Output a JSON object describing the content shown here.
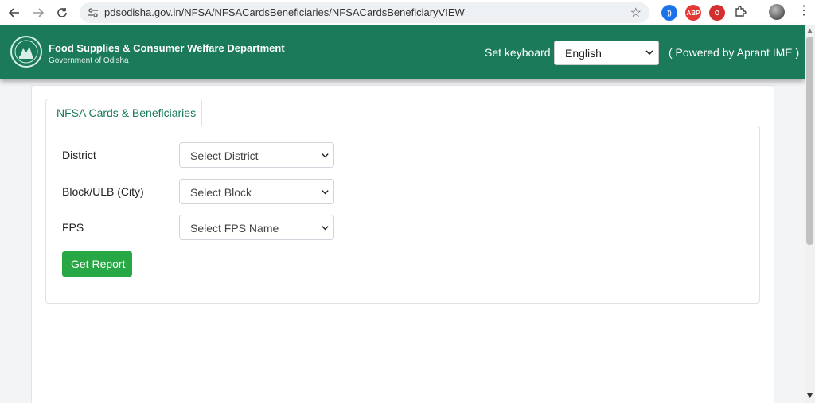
{
  "browser": {
    "url": "pdsodisha.gov.in/NFSA/NFSACardsBeneficiaries/NFSACardsBeneficiaryVIEW",
    "extensions": [
      {
        "name": "speaker-extension-icon",
        "color": "#1a73e8",
        "label": "))"
      },
      {
        "name": "adblock-icon",
        "color": "#e53935",
        "label": "ABP"
      },
      {
        "name": "opera-icon",
        "color": "#d32f2f",
        "label": "O"
      }
    ]
  },
  "header": {
    "department": "Food Supplies & Consumer Welfare Department",
    "government": "Government of Odisha",
    "keyboard_label": "Set keyboard",
    "language_selected": "English",
    "powered_by": "( Powered by Aprant IME )"
  },
  "tabs": [
    {
      "label": "NFSA Cards & Beneficiaries",
      "active": true
    }
  ],
  "form": {
    "district": {
      "label": "District",
      "selected": "Select District"
    },
    "block": {
      "label": "Block/ULB (City)",
      "selected": "Select Block"
    },
    "fps": {
      "label": "FPS",
      "selected": "Select FPS Name"
    },
    "submit_label": "Get Report"
  },
  "colors": {
    "header_bg": "#1a7a5a",
    "tab_text": "#1a7a5a",
    "button_bg": "#28a745"
  }
}
